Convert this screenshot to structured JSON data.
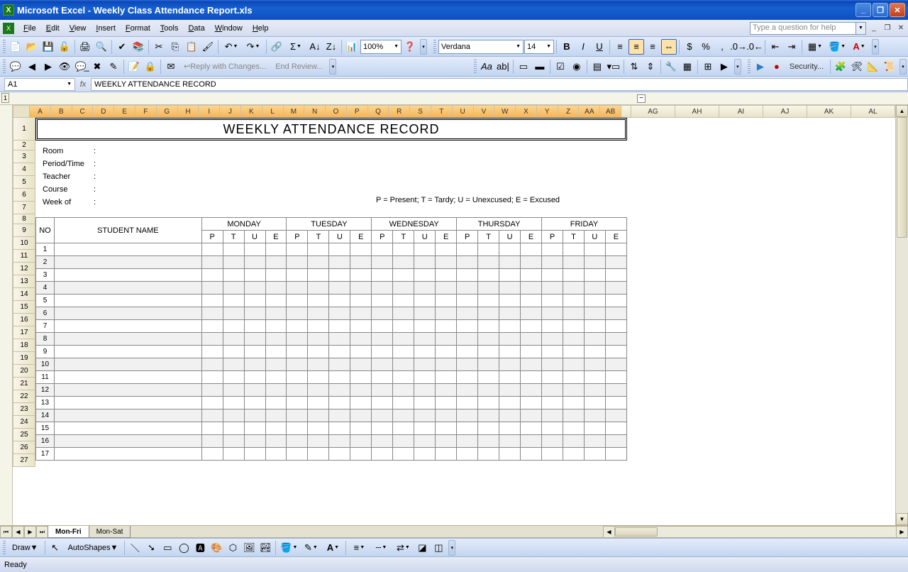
{
  "title": "Microsoft Excel - Weekly Class Attendance Report.xls",
  "menus": [
    "File",
    "Edit",
    "View",
    "Insert",
    "Format",
    "Tools",
    "Data",
    "Window",
    "Help"
  ],
  "help_placeholder": "Type a question for help",
  "font_name": "Verdana",
  "font_size": "14",
  "zoom": "100%",
  "namebox": "A1",
  "formula": "WEEKLY ATTENDANCE RECORD",
  "review": {
    "reply": "Reply with Changes...",
    "end": "End Review..."
  },
  "security_label": "Security...",
  "columns_range": [
    "A",
    "B",
    "C",
    "D",
    "E",
    "F",
    "G",
    "H",
    "I",
    "J",
    "K",
    "L",
    "M",
    "N",
    "O",
    "P",
    "Q",
    "R",
    "S",
    "T",
    "U",
    "V",
    "W",
    "X",
    "Y",
    "Z",
    "AA",
    "AB"
  ],
  "columns_rest": [
    "AG",
    "AH",
    "AI",
    "AJ",
    "AK",
    "AL"
  ],
  "rows": {
    "count": 27
  },
  "doc": {
    "title": "WEEKLY ATTENDANCE RECORD",
    "info": [
      "Room",
      "Period/Time",
      "Teacher",
      "Course",
      "Week of"
    ],
    "legend": "P = Present; T = Tardy; U = Unexcused; E = Excused",
    "headers": {
      "no": "NO",
      "name": "STUDENT NAME",
      "days": [
        "MONDAY",
        "TUESDAY",
        "WEDNESDAY",
        "THURSDAY",
        "FRIDAY"
      ],
      "codes": [
        "P",
        "T",
        "U",
        "E"
      ]
    },
    "student_rows": 17
  },
  "sheet_tabs": [
    "Mon-Fri",
    "Mon-Sat"
  ],
  "draw_label": "Draw",
  "autoshapes_label": "AutoShapes",
  "status": "Ready"
}
